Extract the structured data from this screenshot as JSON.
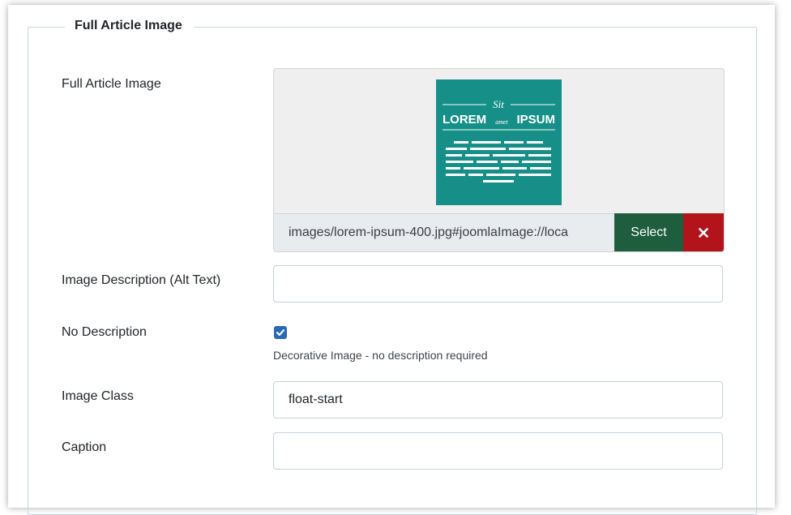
{
  "fieldset": {
    "legend": "Full Article Image"
  },
  "image_field": {
    "label": "Full Article Image",
    "path_value": "images/lorem-ipsum-400.jpg#joomlaImage://loca",
    "select_label": "Select",
    "clear_icon": "times-icon",
    "thumbnail": {
      "top_text": "Sit",
      "left_word": "LOREM",
      "mid_word": "amet",
      "right_word": "IPSUM",
      "background": "#158f87"
    }
  },
  "alt_text": {
    "label": "Image Description (Alt Text)",
    "value": ""
  },
  "no_description": {
    "label": "No Description",
    "checked": true,
    "hint": "Decorative Image - no description required"
  },
  "image_class": {
    "label": "Image Class",
    "value": "float-start"
  },
  "caption": {
    "label": "Caption",
    "value": ""
  },
  "colors": {
    "select_button": "#1e5d3d",
    "clear_button": "#b3141b",
    "checkbox": "#2a69b8",
    "border": "#c9d6e6"
  }
}
